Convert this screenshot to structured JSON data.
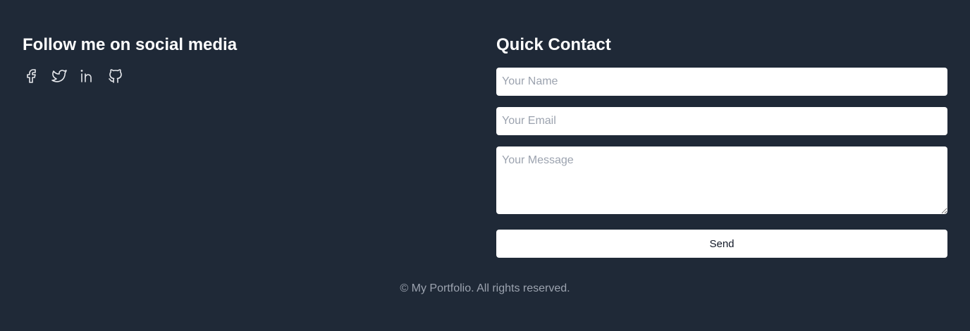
{
  "social": {
    "heading": "Follow me on social media",
    "links": [
      {
        "icon": "facebook-icon"
      },
      {
        "icon": "twitter-icon"
      },
      {
        "icon": "linkedin-icon"
      },
      {
        "icon": "github-icon"
      }
    ]
  },
  "contact": {
    "heading": "Quick Contact",
    "name_placeholder": "Your Name",
    "email_placeholder": "Your Email",
    "message_placeholder": "Your Message",
    "send_label": "Send"
  },
  "footer": {
    "copyright": "© My Portfolio. All rights reserved."
  },
  "colors": {
    "background": "#1f2937",
    "heading": "#ffffff",
    "muted": "#9ca3af",
    "field": "#ffffff"
  }
}
